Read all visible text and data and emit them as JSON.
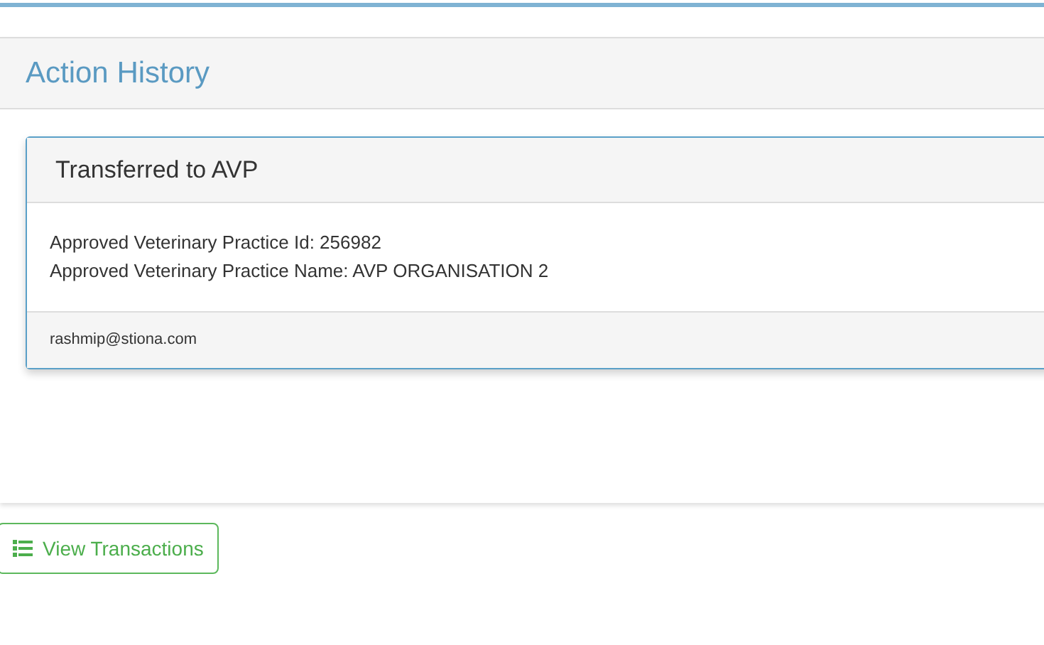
{
  "panel": {
    "title": "Action History"
  },
  "actions": [
    {
      "title": "Transferred to AVP",
      "lines": [
        "Approved Veterinary Practice Id: 256982",
        "Approved Veterinary Practice Name: AVP ORGANISATION 2"
      ],
      "user": "rashmip@stiona.com"
    }
  ],
  "button": {
    "label": "View Transactions"
  }
}
